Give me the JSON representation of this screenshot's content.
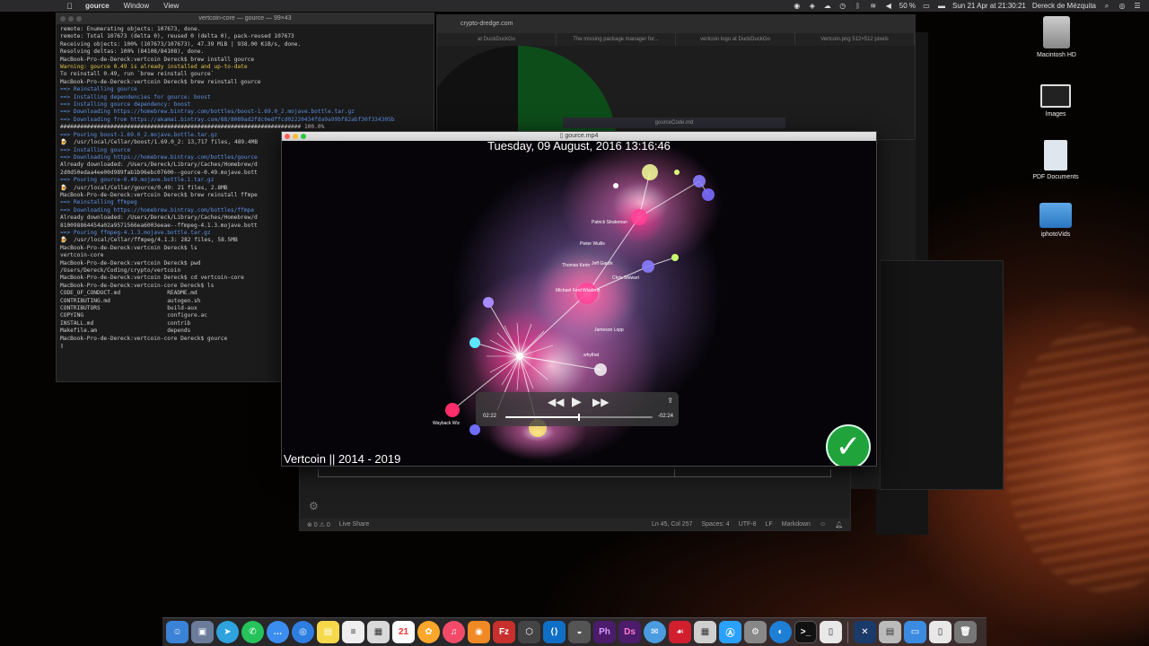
{
  "menubar": {
    "app_name": "gourcе",
    "items": [
      "Window",
      "View"
    ],
    "battery": "50 %",
    "clock": "Sun 21 Apr at 21:30:21",
    "user": "Dereck de Mézquita"
  },
  "desktop_icons": [
    {
      "label": "Macintosh HD",
      "icon": "hard-drive-icon"
    },
    {
      "label": "Images",
      "icon": "photo-icon"
    },
    {
      "label": "PDF Documents",
      "icon": "document-icon"
    },
    {
      "label": "iphotoVids",
      "icon": "folder-icon"
    }
  ],
  "terminal": {
    "title": "vertcoin-core — gource — 99×43",
    "lines": [
      {
        "t": "remote: Enumerating objects: 107673, done.",
        "c": ""
      },
      {
        "t": "remote: Total 107673 (delta 0), reused 0 (delta 0), pack-reused 107673",
        "c": ""
      },
      {
        "t": "Receiving objects: 100% (107673/107673), 47.39 MiB | 938.00 KiB/s, done.",
        "c": ""
      },
      {
        "t": "Resolving deltas: 100% (84108/84108), done.",
        "c": ""
      },
      {
        "t": "MacBook-Pro-de-Dereck:vertcoin Dereck$ brew install gource",
        "c": ""
      },
      {
        "t": "Warning: gource 0.49 is already installed and up-to-date",
        "c": "tl-yellow"
      },
      {
        "t": "To reinstall 0.49, run `brew reinstall gource`",
        "c": ""
      },
      {
        "t": "MacBook-Pro-de-Dereck:vertcoin Dereck$ brew reinstall gource",
        "c": ""
      },
      {
        "t": "==> Reinstalling gource",
        "c": "tl-blue"
      },
      {
        "t": "==> Installing dependencies for gource: boost",
        "c": "tl-blue"
      },
      {
        "t": "==> Installing gource dependency: boost",
        "c": "tl-blue"
      },
      {
        "t": "==> Downloading https://homebrew.bintray.com/bottles/boost-1.69.0_2.mojave.bottle.tar.gz",
        "c": "tl-blue"
      },
      {
        "t": "==> Downloading from https://akamai.bintray.com/88/8089ad2fdc0edffcd02220434fda9a99bf82abf30f334305b",
        "c": "tl-blue"
      },
      {
        "t": "######################################################################## 100.0%",
        "c": ""
      },
      {
        "t": "==> Pouring boost-1.69.0_2.mojave.bottle.tar.gz",
        "c": "tl-blue"
      },
      {
        "t": "🍺  /usr/local/Cellar/boost/1.69.0_2: 13,717 files, 489.4MB",
        "c": ""
      },
      {
        "t": "==> Installing gource",
        "c": "tl-blue"
      },
      {
        "t": "==> Downloading https://homebrew.bintray.com/bottles/gource",
        "c": "tl-blue"
      },
      {
        "t": "Already downloaded: /Users/Dereck/Library/Caches/Homebrew/d",
        "c": ""
      },
      {
        "t": "2d0d50edaa4ee00d989fab1b96ebc07600--gource-0.49.mojave.bott",
        "c": ""
      },
      {
        "t": "==> Pouring gource-0.49.mojave.bottle.1.tar.gz",
        "c": "tl-blue"
      },
      {
        "t": "🍺  /usr/local/Cellar/gource/0.49: 21 files, 2.8MB",
        "c": ""
      },
      {
        "t": "MacBook-Pro-de-Dereck:vertcoin Dereck$ brew reinstall ffmpe",
        "c": ""
      },
      {
        "t": "==> Reinstalling ffmpeg",
        "c": "tl-blue"
      },
      {
        "t": "==> Downloading https://homebrew.bintray.com/bottles/ffmpe",
        "c": "tl-blue"
      },
      {
        "t": "Already downloaded: /Users/Dereck/Library/Caches/Homebrew/d",
        "c": ""
      },
      {
        "t": "810098864454a02a9571566ea6003eeae--ffmpeg-4.1.3.mojave.bott",
        "c": ""
      },
      {
        "t": "==> Pouring ffmpeg-4.1.3.mojave.bottle.tar.gz",
        "c": "tl-blue"
      },
      {
        "t": "🍺  /usr/local/Cellar/ffmpeg/4.1.3: 282 files, 58.5MB",
        "c": ""
      },
      {
        "t": "MacBook-Pro-de-Dereck:vertcoin Dereck$ ls",
        "c": ""
      },
      {
        "t": "vertcoin-core",
        "c": ""
      },
      {
        "t": "MacBook-Pro-de-Dereck:vertcoin Dereck$ pwd",
        "c": ""
      },
      {
        "t": "/Users/Dereck/Coding/crypto/vertcoin",
        "c": ""
      },
      {
        "t": "MacBook-Pro-de-Dereck:vertcoin Dereck$ cd vertcoin-core",
        "c": ""
      },
      {
        "t": "MacBook-Pro-de-Dereck:vertcoin-core Dereck$ ls",
        "c": ""
      },
      {
        "t": "CODE_OF_CONDUCT.md              README.md",
        "c": ""
      },
      {
        "t": "CONTRIBUTING.md                 autogen.sh",
        "c": ""
      },
      {
        "t": "CONTRIBUTORS                    build-aux",
        "c": ""
      },
      {
        "t": "COPYING                         configure.ac",
        "c": ""
      },
      {
        "t": "INSTALL.md                      contrib",
        "c": ""
      },
      {
        "t": "Makefile.am                     depends",
        "c": ""
      },
      {
        "t": "MacBook-Pro-de-Dereck:vertcoin-core Dereck$ gource",
        "c": ""
      },
      {
        "t": "▯",
        "c": ""
      }
    ]
  },
  "browser": {
    "url": "crypto-dredge.com",
    "tabs": [
      "at DuckDuckGo",
      "The missing package manager for...",
      "vertcoin logo at DuckDuckGo",
      "Vertcoin.png 512×512 pixels"
    ],
    "sub_title": "gourceCode.md",
    "side_number": "62"
  },
  "quicktime": {
    "title": "gource.mp4",
    "date_overlay": "Tuesday, 09 August, 2016 13:16:46",
    "video_title": "Vertcoin || 2014 - 2019",
    "current_time": "02:22",
    "remaining_time": "-02:24",
    "progress": 0.5,
    "contributors": [
      "Patrick Strateman",
      "Pieter Wuille",
      "Thomas Kerin",
      "Jeff Garzik",
      "Chris Stewart",
      "Michael Ford",
      "Wladimir",
      "Jameson Lopp",
      "whythat",
      "Wayback Wiz"
    ]
  },
  "editor": {
    "status_left": [
      "⊗ 0 ⚠ 0",
      "Live Share"
    ],
    "status_right": [
      "Ln 45, Col 257",
      "Spaces: 4",
      "UTF-8",
      "LF",
      "Markdown"
    ]
  },
  "dock": {
    "calendar_day": "21"
  },
  "colors": {
    "accent_green": "#1fa33a",
    "terminal_bg": "#1b1b1b",
    "prompt_blue": "#5d8fe0"
  }
}
